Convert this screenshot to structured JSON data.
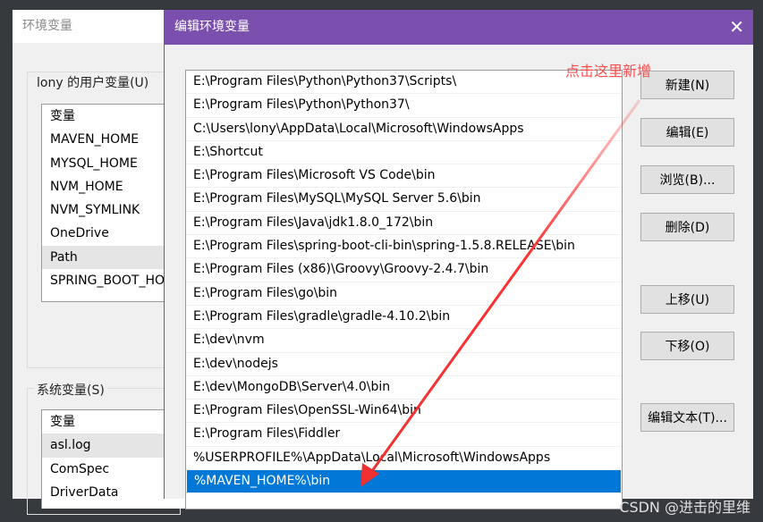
{
  "env_window": {
    "title": "环境变量",
    "user_group": "lony 的用户变量(U)",
    "user_vars": [
      "变量",
      "MAVEN_HOME",
      "MYSQL_HOME",
      "NVM_HOME",
      "NVM_SYMLINK",
      "OneDrive",
      "Path",
      "SPRING_BOOT_HOME"
    ],
    "system_group": "系统变量(S)",
    "system_vars": [
      "变量",
      "asl.log",
      "ComSpec",
      "DriverData"
    ]
  },
  "edit_dialog": {
    "title": "编辑环境变量",
    "close_icon": "close-icon",
    "paths": [
      "E:\\Program Files\\Python\\Python37\\Scripts\\",
      "E:\\Program Files\\Python\\Python37\\",
      "C:\\Users\\lony\\AppData\\Local\\Microsoft\\WindowsApps",
      "E:\\Shortcut",
      "E:\\Program Files\\Microsoft VS Code\\bin",
      "E:\\Program Files\\MySQL\\MySQL Server 5.6\\bin",
      "E:\\Program Files\\Java\\jdk1.8.0_172\\bin",
      "E:\\Program Files\\spring-boot-cli-bin\\spring-1.5.8.RELEASE\\bin",
      "E:\\Program Files (x86)\\Groovy\\Groovy-2.4.7\\bin",
      "E:\\Program Files\\go\\bin",
      "E:\\Program Files\\gradle\\gradle-4.10.2\\bin",
      "E:\\dev\\nvm",
      "E:\\dev\\nodejs",
      "E:\\dev\\MongoDB\\Server\\4.0\\bin",
      "E:\\Program Files\\OpenSSL-Win64\\bin",
      "E:\\Program Files\\Fiddler",
      "%USERPROFILE%\\AppData\\Local\\Microsoft\\WindowsApps",
      "%MAVEN_HOME%\\bin"
    ],
    "buttons": {
      "new": "新建(N)",
      "edit": "编辑(E)",
      "browse": "浏览(B)...",
      "delete": "删除(D)",
      "up": "上移(U)",
      "down": "下移(O)",
      "edit_text": "编辑文本(T)..."
    }
  },
  "annotation": {
    "text": "点击这里新增",
    "color": "#ff4d4d"
  },
  "watermark": "CSDN @进击的里维",
  "colors": {
    "title_bar": "#7b4fae",
    "selection": "#0078d7"
  }
}
